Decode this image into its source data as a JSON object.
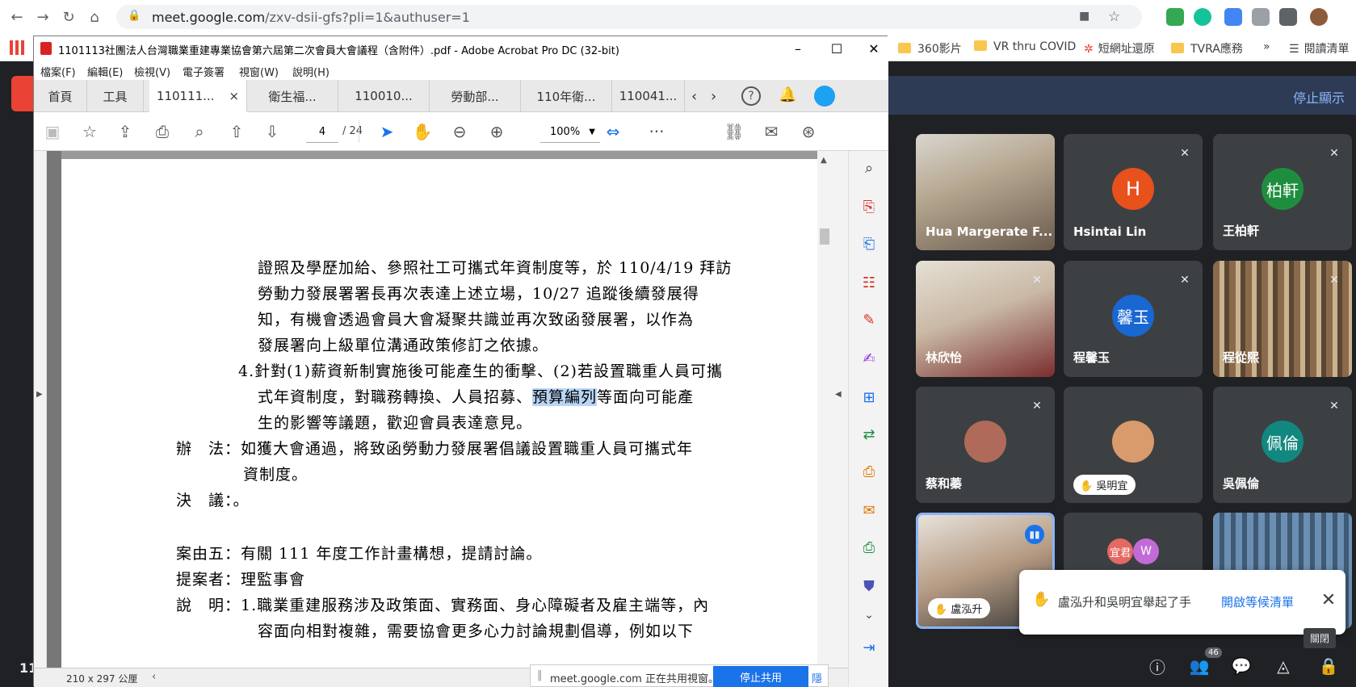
{
  "browser": {
    "url_host": "meet.google.com",
    "url_path": "/zxv-dsii-gfs?pli=1&authuser=1",
    "bookmarks": [
      "360影片",
      "VR thru COVID",
      "短網址還原",
      "TVRA應務"
    ],
    "bookmarks_more": "»",
    "reading_list": "閱讀清單"
  },
  "acrobat": {
    "title": "1101113社團法人台灣職業重建專業協會第六屆第二次會員大會議程（含附件）.pdf - Adobe Acrobat Pro DC (32-bit)",
    "menus": [
      "檔案(F)",
      "編輯(E)",
      "檢視(V)",
      "電子簽署",
      "視窗(W)",
      "說明(H)"
    ],
    "home_tab": "首頁",
    "tools_tab": "工具",
    "tabs": [
      "110111...",
      "衛生福...",
      "110010...",
      "勞動部...",
      "110年衛...",
      "110041..."
    ],
    "tab_close": "×",
    "page_current": "4",
    "page_total": "/ 24",
    "zoom": "100%",
    "page_size": "210 x 297 公厘",
    "doc_lines": [
      "證照及學歷加給、參照社工可攜式年資制度等，於 110/4/19 拜訪",
      "勞動力發展署署長再次表達上述立場，10/27 追蹤後續發展得",
      "知，有機會透過會員大會凝聚共識並再次致函發展署，以作為",
      "發展署向上級單位溝通政策修訂之依據。",
      "4.針對(1)薪資新制實施後可能產生的衝擊、(2)若設置職重人員可攜",
      "生的影響等議題，歡迎會員表達意見。",
      "辦　法：如獲大會通過，將致函勞動力發展署倡議設置職重人員可攜式年",
      "資制度。",
      "決　議：。",
      "案由五：有關 111 年度工作計畫構想，提請討論。",
      "提案者：理監事會",
      "說　明：1.職業重建服務涉及政策面、實務面、身心障礙者及雇主端等，內",
      "容面向相對複雜，需要協會更多心力討論規劃倡導，例如以下"
    ],
    "doc_line_5_pre": "式年資制度，對職務轉換、人員招募、",
    "doc_line_5_hl": "預算編列",
    "doc_line_5_post": "等面向可能產"
  },
  "share": {
    "text": "meet.google.com 正在共用視窗。",
    "stop": "停止共用",
    "hide": "隱藏"
  },
  "meet": {
    "stop_presenting": "停止顯示",
    "participants": [
      {
        "name": "Hua Margerate F...",
        "type": "photo"
      },
      {
        "name": "Hsintai Lin",
        "initial": "H",
        "color": "#e8501c",
        "muted": true
      },
      {
        "name": "王柏軒",
        "initial": "柏軒",
        "color": "#1e8e3e",
        "muted": true
      },
      {
        "name": "林欣怡",
        "type": "photo",
        "muted": true
      },
      {
        "name": "程馨玉",
        "initial": "馨玉",
        "color": "#1967d2",
        "muted": true
      },
      {
        "name": "程從熙",
        "type": "photo",
        "muted": true
      },
      {
        "name": "蔡和蓁",
        "type": "avatar",
        "muted": true
      },
      {
        "name": "吳明宜",
        "type": "avatar",
        "hand": true
      },
      {
        "name": "吳佩倫",
        "initial": "佩倫",
        "color": "#12877f",
        "muted": true
      },
      {
        "name": "盧泓升",
        "type": "photo",
        "hand": true,
        "speaking": true
      },
      {
        "name": "",
        "type": "pair",
        "initials": [
          "宜君",
          "W"
        ]
      },
      {
        "name": "",
        "type": "photo"
      }
    ],
    "raise_notice": "盧泓升和吳明宜舉起了手",
    "open_queue": "開啟等候清單",
    "close_tooltip": "關閉",
    "people_count": "46",
    "time": "11:"
  }
}
